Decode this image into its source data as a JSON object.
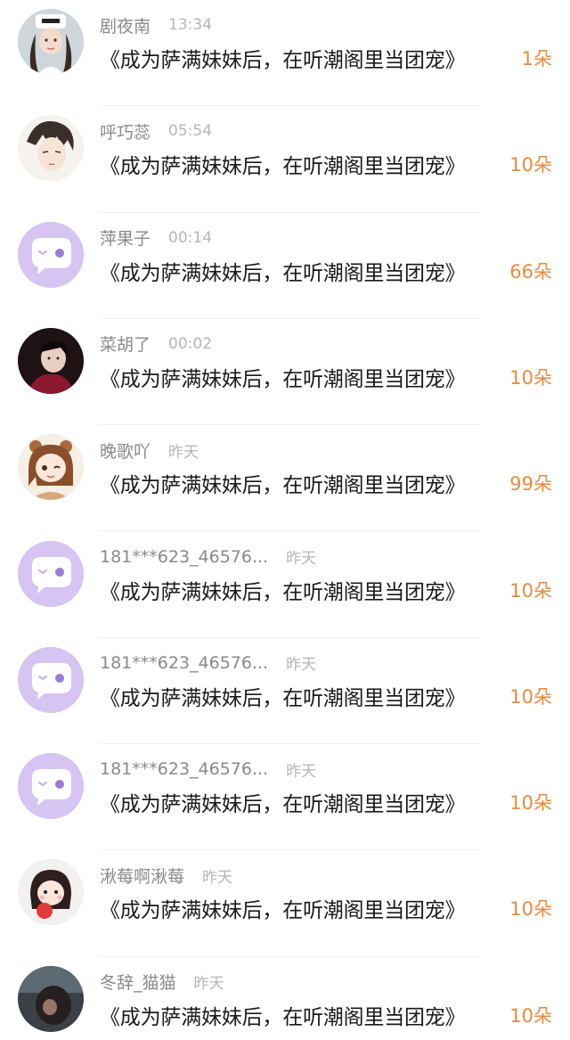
{
  "colors": {
    "gift_accent": "#ec8a3f",
    "default_avatar_bg": "#d6c4f2",
    "name_color": "#8a8a8a",
    "time_color": "#b6b6b6"
  },
  "items": [
    {
      "name": "剧夜南",
      "time": "13:34",
      "book": "《成为萨满妹妹后，在听潮阁里当团宠》",
      "gift": "1朵",
      "avatar": "photo-girl-hat"
    },
    {
      "name": "呼巧蕊",
      "time": "05:54",
      "book": "《成为萨满妹妹后，在听潮阁里当团宠》",
      "gift": "10朵",
      "avatar": "anime-boy"
    },
    {
      "name": "萍果子",
      "time": "00:14",
      "book": "《成为萨满妹妹后，在听潮阁里当团宠》",
      "gift": "66朵",
      "avatar": "default-chat-bubble"
    },
    {
      "name": "菜胡了",
      "time": "00:02",
      "book": "《成为萨满妹妹后，在听潮阁里当团宠》",
      "gift": "10朵",
      "avatar": "photo-person-dark"
    },
    {
      "name": "晚歌吖",
      "time": "昨天",
      "book": "《成为萨满妹妹后，在听潮阁里当团宠》",
      "gift": "99朵",
      "avatar": "cartoon-girl-bear"
    },
    {
      "name": "181***623_46576...",
      "time": "昨天",
      "book": "《成为萨满妹妹后，在听潮阁里当团宠》",
      "gift": "10朵",
      "avatar": "default-chat-bubble"
    },
    {
      "name": "181***623_46576...",
      "time": "昨天",
      "book": "《成为萨满妹妹后，在听潮阁里当团宠》",
      "gift": "10朵",
      "avatar": "default-chat-bubble"
    },
    {
      "name": "181***623_46576...",
      "time": "昨天",
      "book": "《成为萨满妹妹后，在听潮阁里当团宠》",
      "gift": "10朵",
      "avatar": "default-chat-bubble"
    },
    {
      "name": "湫莓啊湫莓",
      "time": "昨天",
      "book": "《成为萨满妹妹后，在听潮阁里当团宠》",
      "gift": "10朵",
      "avatar": "cartoon-girl-apple"
    },
    {
      "name": "冬辞_猫猫",
      "time": "昨天",
      "book": "《成为萨满妹妹后，在听潮阁里当团宠》",
      "gift": "10朵",
      "avatar": "photo-dark"
    }
  ]
}
